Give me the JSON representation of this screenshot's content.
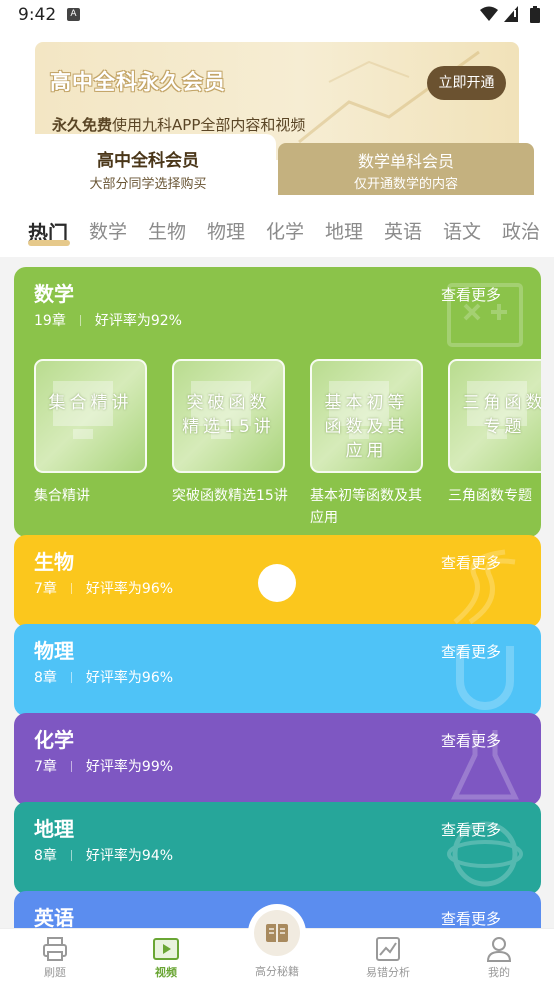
{
  "status": {
    "time": "9:42",
    "notif": "A"
  },
  "banner": {
    "title": "高中全科永久会员",
    "sub_bold": "永久免费",
    "sub_rest": "使用九科APP全部内容和视频",
    "button": "立即开通"
  },
  "membership_tabs": [
    {
      "title": "高中全科会员",
      "desc": "大部分同学选择购买"
    },
    {
      "title": "数学单科会员",
      "desc": "仅开通数学的内容"
    }
  ],
  "subject_tabs": [
    "热门",
    "数学",
    "生物",
    "物理",
    "化学",
    "地理",
    "英语",
    "语文",
    "政治"
  ],
  "cards": {
    "math": {
      "title": "数学",
      "chapters": "19章",
      "rating": "好评率为92%",
      "more": "查看更多",
      "courses": [
        {
          "thumb": "集合精讲",
          "label": "集合精讲"
        },
        {
          "thumb": "突破函数精选15讲",
          "label": "突破函数精选15讲"
        },
        {
          "thumb": "基本初等函数及其应用",
          "label": "基本初等函数及其应用"
        },
        {
          "thumb": "三角函数专题",
          "label": "三角函数专题"
        }
      ]
    },
    "bio": {
      "title": "生物",
      "chapters": "7章",
      "rating": "好评率为96%",
      "more": "查看更多"
    },
    "phy": {
      "title": "物理",
      "chapters": "8章",
      "rating": "好评率为96%",
      "more": "查看更多"
    },
    "chem": {
      "title": "化学",
      "chapters": "7章",
      "rating": "好评率为99%",
      "more": "查看更多"
    },
    "geo": {
      "title": "地理",
      "chapters": "8章",
      "rating": "好评率为94%",
      "more": "查看更多"
    },
    "eng": {
      "title": "英语",
      "more": "查看更多"
    }
  },
  "bottom_nav": [
    {
      "label": "刷题",
      "icon": "printer-icon"
    },
    {
      "label": "视频",
      "icon": "video-icon"
    },
    {
      "label": "高分秘籍",
      "icon": "book-icon"
    },
    {
      "label": "易错分析",
      "icon": "chart-icon"
    },
    {
      "label": "我的",
      "icon": "user-icon"
    }
  ],
  "colors": {
    "math": "#8bc34a",
    "bio": "#fbc71d",
    "phy": "#4fc3f7",
    "chem": "#7e57c2",
    "geo": "#26a69a",
    "eng": "#5b8def",
    "nav_active": "#6aa634"
  }
}
